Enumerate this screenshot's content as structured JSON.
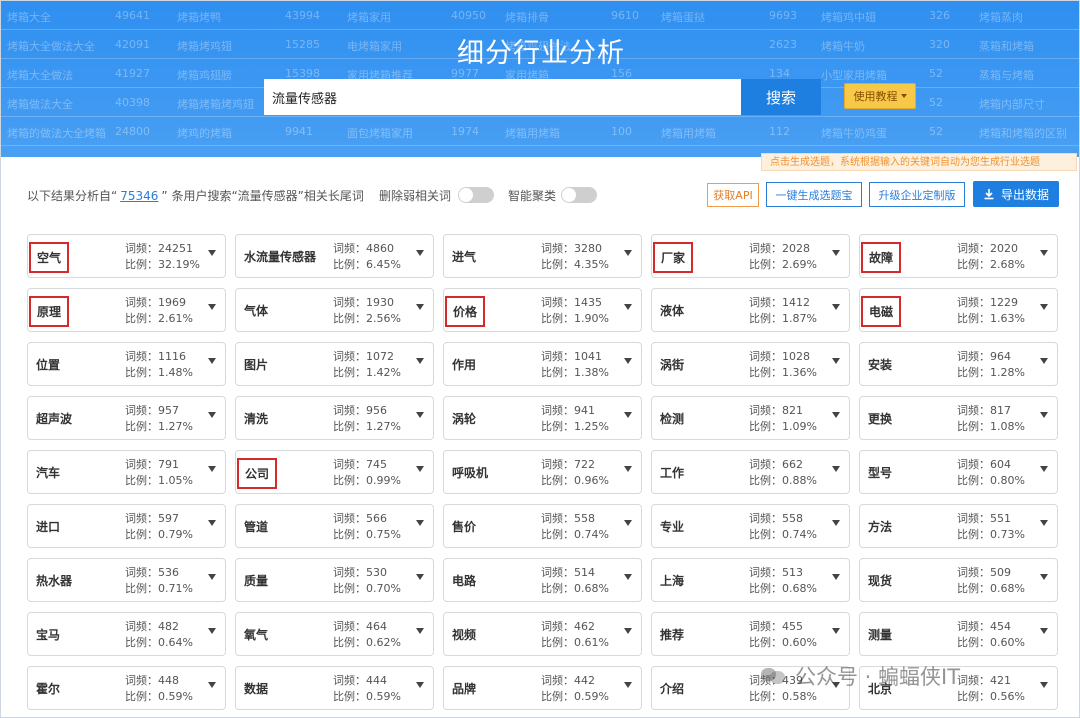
{
  "colors": {
    "header_blue": "#3d98f2",
    "highlight_red": "#d42a2a",
    "link_blue": "#2a7ed8",
    "accent_orange": "#f0922e"
  },
  "header": {
    "title": "细分行业分析",
    "search": {
      "value": "流量传感器",
      "button": "搜索"
    },
    "tutorial_button": "使用教程",
    "tutorial_icon": "caret-down-icon",
    "tip": "点击生成选题，系统根据输入的关键词自动为您生成行业选题",
    "background_rows": [
      [
        "烤箱大全",
        "49641",
        "烤箱烤鸭",
        "43994",
        "烤箱家用",
        "40950",
        "烤箱排骨",
        "9610",
        "烤箱蛋挞",
        "9693",
        "烤箱鸡中翅",
        "326",
        "烤箱蒸肉"
      ],
      [
        "烤箱大全做法大全",
        "42091",
        "烤箱烤鸡翅",
        "15285",
        "电烤箱家用",
        "",
        "烤箱鸡翅做法",
        "",
        "",
        "2623",
        "烤箱牛奶",
        "320",
        "蒸箱和烤箱"
      ],
      [
        "烤箱大全做法",
        "41927",
        "烤箱鸡翅膀",
        "15398",
        "家用烤箱推荐",
        "9977",
        "家用烤箱",
        "156",
        "",
        "134",
        "小型家用烤箱",
        "52",
        "蒸箱与烤箱"
      ],
      [
        "烤箱做法大全",
        "40398",
        "烤箱烤箱烤鸡翅",
        "",
        "",
        "",
        "",
        "",
        "",
        "",
        "",
        "52",
        "烤箱内部尺寸"
      ],
      [
        "烤箱的做法大全烤箱",
        "24800",
        "烤鸡的烤箱",
        "9941",
        "面包烤箱家用",
        "1974",
        "烤箱用烤箱",
        "100",
        "烤箱用烤箱",
        "112",
        "烤箱牛奶鸡蛋",
        "52",
        "烤箱和烤箱的区别"
      ]
    ]
  },
  "toolbar": {
    "summary_prefix": "以下结果分析自“",
    "summary_count": "75346",
    "summary_suffix": "” 条用户搜索“流量传感器”相关长尾词",
    "toggle_weak": "删除弱相关词",
    "toggle_cluster": "智能聚类",
    "api_button": "获取API",
    "generate_button": "一键生成选题宝",
    "upgrade_button": "升级企业定制版",
    "export_button": "导出数据",
    "export_icon": "download-icon"
  },
  "cards": [
    {
      "keyword": "空气",
      "freq": "词频：24251",
      "ratio": "比例：32.19%",
      "hl": true
    },
    {
      "keyword": "水流量传感器",
      "freq": "词频：4860",
      "ratio": "比例：6.45%",
      "hl": false
    },
    {
      "keyword": "进气",
      "freq": "词频：3280",
      "ratio": "比例：4.35%",
      "hl": false
    },
    {
      "keyword": "厂家",
      "freq": "词频：2028",
      "ratio": "比例：2.69%",
      "hl": true
    },
    {
      "keyword": "故障",
      "freq": "词频：2020",
      "ratio": "比例：2.68%",
      "hl": true
    },
    {
      "keyword": "原理",
      "freq": "词频：1969",
      "ratio": "比例：2.61%",
      "hl": true
    },
    {
      "keyword": "气体",
      "freq": "词频：1930",
      "ratio": "比例：2.56%",
      "hl": false
    },
    {
      "keyword": "价格",
      "freq": "词频：1435",
      "ratio": "比例：1.90%",
      "hl": true
    },
    {
      "keyword": "液体",
      "freq": "词频：1412",
      "ratio": "比例：1.87%",
      "hl": false
    },
    {
      "keyword": "电磁",
      "freq": "词频：1229",
      "ratio": "比例：1.63%",
      "hl": true
    },
    {
      "keyword": "位置",
      "freq": "词频：1116",
      "ratio": "比例：1.48%",
      "hl": false
    },
    {
      "keyword": "图片",
      "freq": "词频：1072",
      "ratio": "比例：1.42%",
      "hl": false
    },
    {
      "keyword": "作用",
      "freq": "词频：1041",
      "ratio": "比例：1.38%",
      "hl": false
    },
    {
      "keyword": "涡街",
      "freq": "词频：1028",
      "ratio": "比例：1.36%",
      "hl": false
    },
    {
      "keyword": "安装",
      "freq": "词频：964",
      "ratio": "比例：1.28%",
      "hl": false
    },
    {
      "keyword": "超声波",
      "freq": "词频：957",
      "ratio": "比例：1.27%",
      "hl": false
    },
    {
      "keyword": "清洗",
      "freq": "词频：956",
      "ratio": "比例：1.27%",
      "hl": false
    },
    {
      "keyword": "涡轮",
      "freq": "词频：941",
      "ratio": "比例：1.25%",
      "hl": false
    },
    {
      "keyword": "检测",
      "freq": "词频：821",
      "ratio": "比例：1.09%",
      "hl": false
    },
    {
      "keyword": "更换",
      "freq": "词频：817",
      "ratio": "比例：1.08%",
      "hl": false
    },
    {
      "keyword": "汽车",
      "freq": "词频：791",
      "ratio": "比例：1.05%",
      "hl": false
    },
    {
      "keyword": "公司",
      "freq": "词频：745",
      "ratio": "比例：0.99%",
      "hl": true
    },
    {
      "keyword": "呼吸机",
      "freq": "词频：722",
      "ratio": "比例：0.96%",
      "hl": false
    },
    {
      "keyword": "工作",
      "freq": "词频：662",
      "ratio": "比例：0.88%",
      "hl": false
    },
    {
      "keyword": "型号",
      "freq": "词频：604",
      "ratio": "比例：0.80%",
      "hl": false
    },
    {
      "keyword": "进口",
      "freq": "词频：597",
      "ratio": "比例：0.79%",
      "hl": false
    },
    {
      "keyword": "管道",
      "freq": "词频：566",
      "ratio": "比例：0.75%",
      "hl": false
    },
    {
      "keyword": "售价",
      "freq": "词频：558",
      "ratio": "比例：0.74%",
      "hl": false
    },
    {
      "keyword": "专业",
      "freq": "词频：558",
      "ratio": "比例：0.74%",
      "hl": false
    },
    {
      "keyword": "方法",
      "freq": "词频：551",
      "ratio": "比例：0.73%",
      "hl": false
    },
    {
      "keyword": "热水器",
      "freq": "词频：536",
      "ratio": "比例：0.71%",
      "hl": false
    },
    {
      "keyword": "质量",
      "freq": "词频：530",
      "ratio": "比例：0.70%",
      "hl": false
    },
    {
      "keyword": "电路",
      "freq": "词频：514",
      "ratio": "比例：0.68%",
      "hl": false
    },
    {
      "keyword": "上海",
      "freq": "词频：513",
      "ratio": "比例：0.68%",
      "hl": false
    },
    {
      "keyword": "现货",
      "freq": "词频：509",
      "ratio": "比例：0.68%",
      "hl": false
    },
    {
      "keyword": "宝马",
      "freq": "词频：482",
      "ratio": "比例：0.64%",
      "hl": false
    },
    {
      "keyword": "氧气",
      "freq": "词频：464",
      "ratio": "比例：0.62%",
      "hl": false
    },
    {
      "keyword": "视频",
      "freq": "词频：462",
      "ratio": "比例：0.61%",
      "hl": false
    },
    {
      "keyword": "推荐",
      "freq": "词频：455",
      "ratio": "比例：0.60%",
      "hl": false
    },
    {
      "keyword": "测量",
      "freq": "词频：454",
      "ratio": "比例：0.60%",
      "hl": false
    },
    {
      "keyword": "霍尔",
      "freq": "词频：448",
      "ratio": "比例：0.59%",
      "hl": false
    },
    {
      "keyword": "数据",
      "freq": "词频：444",
      "ratio": "比例：0.59%",
      "hl": false
    },
    {
      "keyword": "品牌",
      "freq": "词频：442",
      "ratio": "比例：0.59%",
      "hl": false
    },
    {
      "keyword": "介绍",
      "freq": "词频：439",
      "ratio": "比例：0.58%",
      "hl": false
    },
    {
      "keyword": "北京",
      "freq": "词频：421",
      "ratio": "比例：0.56%",
      "hl": false
    }
  ],
  "watermark": {
    "text": "公众号 · 蝙蝠侠IT",
    "icon": "wechat-icon"
  }
}
